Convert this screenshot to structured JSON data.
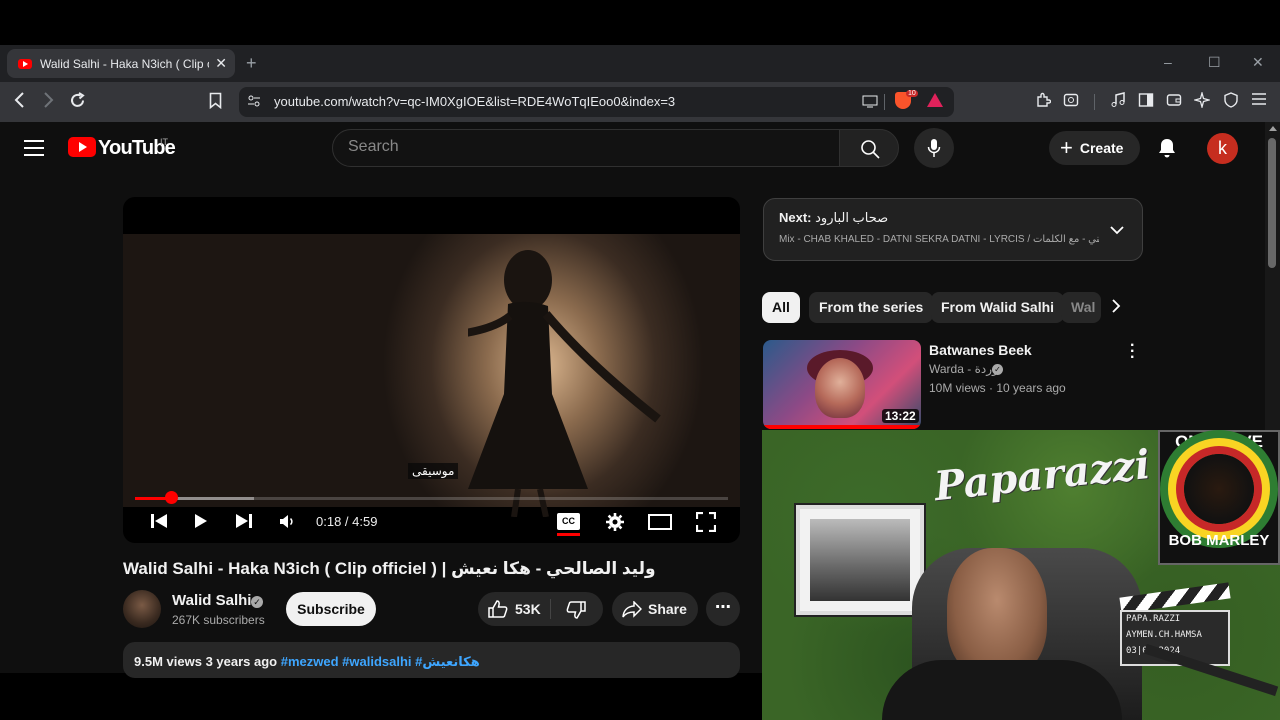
{
  "browser": {
    "tab_title": "Walid Salhi - Haka N3ich ( Clip o",
    "new_tab": "+",
    "url": "youtube.com/watch?v=qc-IM0XgIOE&list=RDE4WoTqIEoo0&index=3",
    "brave_badge": "10",
    "window": {
      "minimize": "–",
      "maximize": "☐",
      "close": "✕"
    }
  },
  "header": {
    "logo_text": "YouTube",
    "country": "IT",
    "search_placeholder": "Search",
    "create_label": "Create",
    "avatar_letter": "k"
  },
  "player": {
    "caption": "موسيقى",
    "time": "0:18 / 4:59",
    "progress_played": 0.06,
    "progress_buffered": 0.2,
    "cc_label": "CC"
  },
  "video": {
    "title": "Walid Salhi - Haka N3ich ( Clip officiel ) | وليد الصالحي - هكا نعيش",
    "channel": "Walid Salhi",
    "subscribers": "267K subscribers",
    "subscribe_label": "Subscribe",
    "likes": "53K",
    "share_label": "Share",
    "more_label": "⋯",
    "views": "9.5M views",
    "age": "3 years ago",
    "hashtags": "#mezwed #walidsalhi #هكانعيش"
  },
  "next_panel": {
    "next_label": "Next:",
    "next_title": "صحاب البارود",
    "mix_line": "Mix - CHAB KHALED - DATNI SEKRA DATNI - LYRCIS / داتني - مع الكلمات..."
  },
  "chips": [
    "All",
    "From the series",
    "From Walid Salhi",
    "Wal"
  ],
  "related": [
    {
      "title": "Batwanes Beek",
      "channel": "Warda - وردة",
      "meta": "10M views · 10 years ago",
      "duration": "13:22"
    }
  ],
  "webcam": {
    "neon": "Paparazzi",
    "poster_top": "ONE LOVE",
    "poster_bottom": "BOB MARLEY",
    "clapper_lines": [
      "PAPA.RAZZI",
      "AYMEN.CH.HAMSA",
      "03|07 2024"
    ]
  },
  "colors": {
    "brand_red": "#ff0000",
    "page_bg": "#0f0f0f",
    "link_blue": "#3ea6ff",
    "avatar_bg": "#c62d1f"
  }
}
